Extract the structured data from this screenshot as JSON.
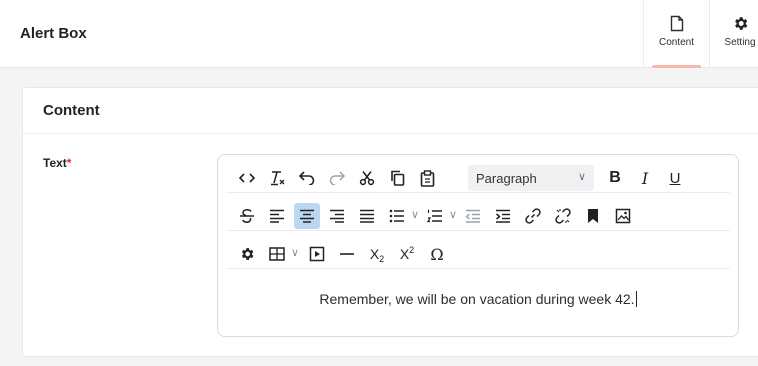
{
  "header": {
    "title": "Alert Box"
  },
  "tabs": [
    {
      "label": "Content",
      "icon": "document-icon",
      "active": true
    },
    {
      "label": "Setting",
      "icon": "gear-icon",
      "active": false
    }
  ],
  "card": {
    "title": "Content",
    "field": {
      "label": "Text",
      "required_mark": "*"
    }
  },
  "toolbar": {
    "block_format": "Paragraph",
    "row1": [
      "source-code",
      "clear-formatting",
      "undo",
      "redo",
      "cut",
      "copy",
      "paste",
      "block-format-select",
      "bold",
      "italic",
      "underline"
    ],
    "row2": [
      "strikethrough",
      "align-left",
      "align-center",
      "align-right",
      "justify",
      "bullet-list",
      "numbered-list",
      "outdent",
      "indent",
      "link",
      "unlink",
      "bookmark",
      "image"
    ],
    "row3": [
      "settings",
      "table",
      "media",
      "horizontal-rule",
      "subscript",
      "superscript",
      "special-character"
    ],
    "active": "align-center",
    "glyphs": {
      "bold": "B",
      "italic": "I",
      "underline": "U",
      "subscript_base": "X",
      "subscript_mark": "2",
      "superscript_base": "X",
      "superscript_mark": "2",
      "omega": "Ω"
    }
  },
  "editor": {
    "content": "Remember, we will be on vacation during week 42."
  },
  "colors": {
    "active_tab_underline": "#f7b9ad",
    "active_button": "#bcd7f0",
    "required": "#e03131"
  }
}
